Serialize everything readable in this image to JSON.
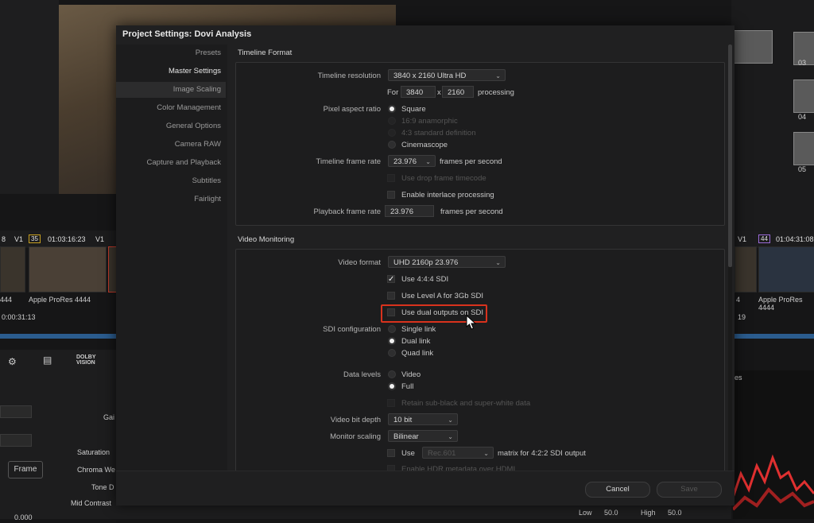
{
  "background": {
    "timecode_left": "01:03:16:23",
    "timecode_right": "01:04:31:08",
    "track_left": "V1",
    "track_mid": "V1",
    "track_right": "V1",
    "badge_left": "35",
    "badge_right": "44",
    "badge_left_num": "8",
    "clip_label_left": "Apple ProRes 4444",
    "clip_label_right": "Apple ProRes 4444",
    "clip_prefix_left": "444",
    "clip_prefix_right": "4",
    "time_left": "0:00:31:13",
    "time_right": "19",
    "node_labels": [
      "03",
      "04",
      "05"
    ],
    "dolby_label": "DOLBY\nVISION",
    "param_labels": [
      "Gai",
      "Saturation",
      "Chroma We",
      "Tone D",
      "Mid Contrast"
    ],
    "frame_button": "Frame",
    "scope_label": "es",
    "low_label": "Low",
    "low_value": "50.0",
    "high_label": "High",
    "high_value": "50.0",
    "bottom_value": "0.000"
  },
  "modal": {
    "title": "Project Settings:  Dovi Analysis",
    "sidebar": [
      "Presets",
      "Master Settings",
      "Image Scaling",
      "Color Management",
      "General Options",
      "Camera RAW",
      "Capture and Playback",
      "Subtitles",
      "Fairlight"
    ],
    "timeline_format": {
      "title": "Timeline Format",
      "resolution_label": "Timeline resolution",
      "resolution_value": "3840 x 2160 Ultra HD",
      "for_label": "For",
      "width": "3840",
      "x_label": "x",
      "height": "2160",
      "processing_label": "processing",
      "par_label": "Pixel aspect ratio",
      "par_options": [
        "Square",
        "16:9 anamorphic",
        "4:3 standard definition",
        "Cinemascope"
      ],
      "frame_rate_label": "Timeline frame rate",
      "frame_rate_value": "23.976",
      "fps_label": "frames per second",
      "drop_frame": "Use drop frame timecode",
      "interlace": "Enable interlace processing",
      "playback_label": "Playback frame rate",
      "playback_value": "23.976",
      "playback_fps": "frames per second"
    },
    "video_monitoring": {
      "title": "Video Monitoring",
      "format_label": "Video format",
      "format_value": "UHD 2160p 23.976",
      "use_444": "Use 4:4:4 SDI",
      "use_level_a": "Use Level A for 3Gb SDI",
      "use_dual": "Use dual outputs on SDI",
      "sdi_label": "SDI configuration",
      "sdi_options": [
        "Single link",
        "Dual link",
        "Quad link"
      ],
      "data_levels_label": "Data levels",
      "data_levels_options": [
        "Video",
        "Full"
      ],
      "retain": "Retain sub-black and super-white data",
      "bit_depth_label": "Video bit depth",
      "bit_depth_value": "10 bit",
      "scaling_label": "Monitor scaling",
      "scaling_value": "Bilinear",
      "use_label": "Use",
      "matrix_value": "Rec.601",
      "matrix_label": "matrix for 4:2:2 SDI output",
      "hdr_label": "Enable HDR metadata over HDMI"
    },
    "footer": {
      "cancel": "Cancel",
      "save": "Save"
    }
  }
}
